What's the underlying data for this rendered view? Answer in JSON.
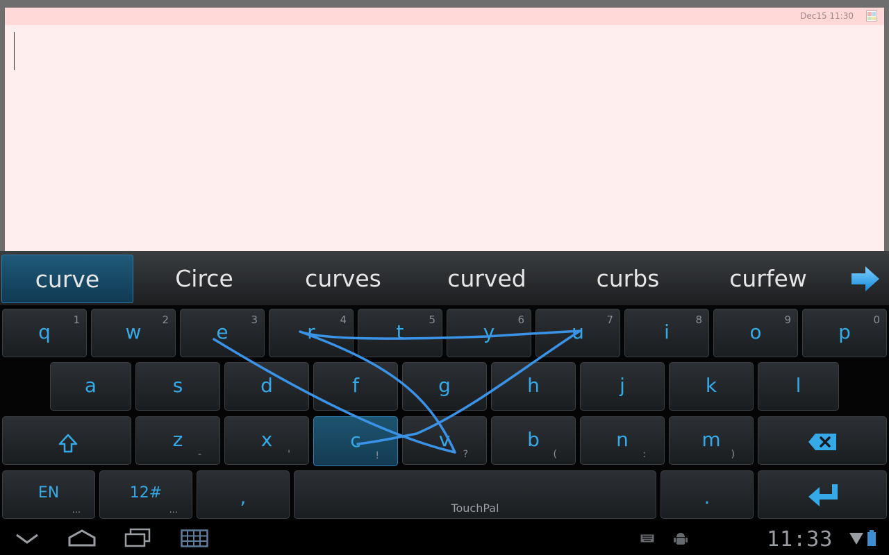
{
  "note": {
    "date": "Dec15 11:30",
    "menu_icon": "color-grid-icon",
    "text": ""
  },
  "candidates": {
    "items": [
      "curve",
      "Circe",
      "curves",
      "curved",
      "curbs",
      "curfew"
    ],
    "selected_index": 0,
    "more_icon": "arrow-right-icon"
  },
  "keyboard": {
    "row1": [
      {
        "main": "q",
        "hint": "1"
      },
      {
        "main": "w",
        "hint": "2"
      },
      {
        "main": "e",
        "hint": "3"
      },
      {
        "main": "r",
        "hint": "4"
      },
      {
        "main": "t",
        "hint": "5"
      },
      {
        "main": "y",
        "hint": "6"
      },
      {
        "main": "u",
        "hint": "7"
      },
      {
        "main": "i",
        "hint": "8"
      },
      {
        "main": "o",
        "hint": "9"
      },
      {
        "main": "p",
        "hint": "0"
      }
    ],
    "row2": [
      "a",
      "s",
      "d",
      "f",
      "g",
      "h",
      "j",
      "k",
      "l"
    ],
    "row3": [
      {
        "main": "z",
        "sub": "-"
      },
      {
        "main": "x",
        "sub": "'"
      },
      {
        "main": "c",
        "sub": "!"
      },
      {
        "main": "v",
        "sub": "?"
      },
      {
        "main": "b",
        "sub": "("
      },
      {
        "main": "n",
        "sub": ":"
      },
      {
        "main": "m",
        "sub": ")"
      }
    ],
    "pressed_key": "c",
    "shift_icon": "shift-arrow-icon",
    "backspace_icon": "backspace-icon",
    "lang_label": "EN",
    "lang_dots": "...",
    "symbols_label": "12#",
    "symbols_dots": "...",
    "comma_label": ",",
    "space_label": "TouchPal",
    "period_label": ".",
    "enter_icon": "enter-arrow-icon",
    "accent": "#36a9e8"
  },
  "navbar": {
    "back_icon": "back-icon",
    "home_icon": "home-icon",
    "recents_icon": "recent-apps-icon",
    "keyboard_toggle_icon": "keyboard-icon",
    "status_keyboard_icon": "keyboard-status-icon",
    "status_debug_icon": "android-debug-icon",
    "clock": "11:33",
    "wifi_icon": "wifi-icon",
    "battery_icon": "battery-icon"
  }
}
